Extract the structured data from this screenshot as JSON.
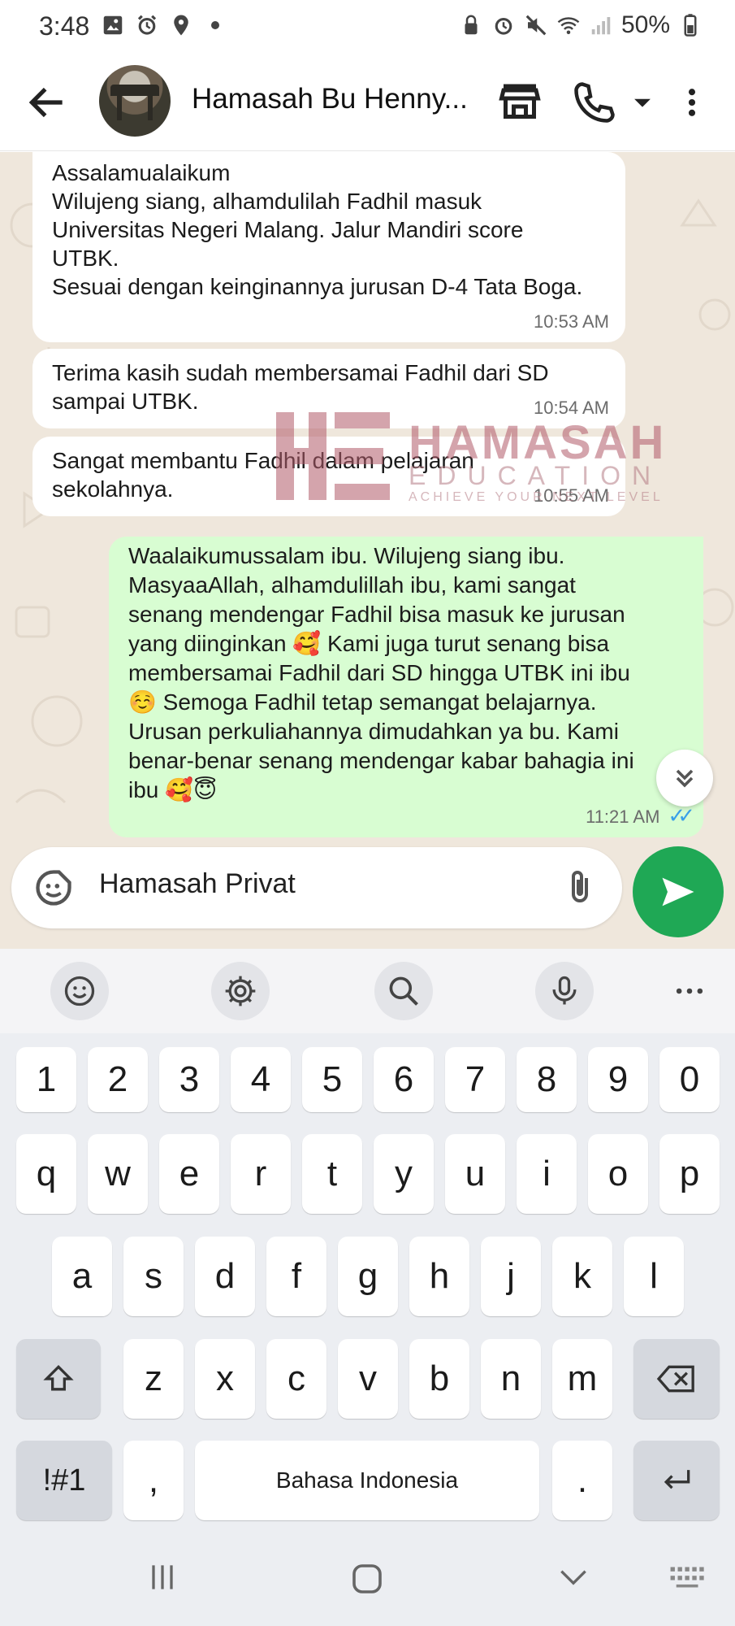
{
  "status_bar": {
    "time": "3:48",
    "battery": "50%"
  },
  "header": {
    "contact_name": "Hamasah Bu Henny..."
  },
  "watermark": {
    "brand": "HAMASAH",
    "sub": "EDUCATION",
    "tagline": "ACHIEVE YOUR NEXT LEVEL"
  },
  "messages": [
    {
      "direction": "in",
      "text": "Assalamualaikum\nWilujeng siang, alhamdulilah Fadhil masuk\nUniversitas Negeri Malang.  Jalur Mandiri score\nUTBK.\nSesuai dengan keinginannya jurusan D-4 Tata Boga.",
      "time": "10:53 AM"
    },
    {
      "direction": "in",
      "text": "Terima kasih sudah membersamai Fadhil dari SD\nsampai UTBK.",
      "time": "10:54 AM"
    },
    {
      "direction": "in",
      "text": "Sangat membantu Fadhil dalam pelajaran\nsekolahnya.",
      "time": "10:55 AM"
    },
    {
      "direction": "out",
      "text": "Waalaikumussalam ibu. Wilujeng siang ibu.\nMasyaaAllah, alhamdulillah ibu, kami sangat\nsenang mendengar Fadhil bisa masuk ke jurusan\nyang diinginkan 🥰 Kami juga turut senang bisa\nmembersamai Fadhil dari SD hingga UTBK ini ibu\n☺️ Semoga Fadhil tetap semangat belajarnya.\nUrusan perkuliahannya dimudahkan ya bu. Kami\nbenar-benar senang mendengar kabar bahagia ini\nibu 🥰😇",
      "time": "11:21 AM"
    }
  ],
  "composer": {
    "text": "Hamasah Privat"
  },
  "keyboard": {
    "numbers": [
      "1",
      "2",
      "3",
      "4",
      "5",
      "6",
      "7",
      "8",
      "9",
      "0"
    ],
    "row1": [
      "q",
      "w",
      "e",
      "r",
      "t",
      "y",
      "u",
      "i",
      "o",
      "p"
    ],
    "row2": [
      "a",
      "s",
      "d",
      "f",
      "g",
      "h",
      "j",
      "k",
      "l"
    ],
    "row3": [
      "z",
      "x",
      "c",
      "v",
      "b",
      "n",
      "m"
    ],
    "symbols_key": "!#1",
    "comma_key": ",",
    "space_label": "Bahasa Indonesia",
    "period_key": "."
  },
  "colors": {
    "chat_bg": "#efe7dc",
    "outgoing_bubble": "#d8fdd2",
    "send_button": "#1fa855",
    "read_ticks": "#3aa0e8"
  }
}
